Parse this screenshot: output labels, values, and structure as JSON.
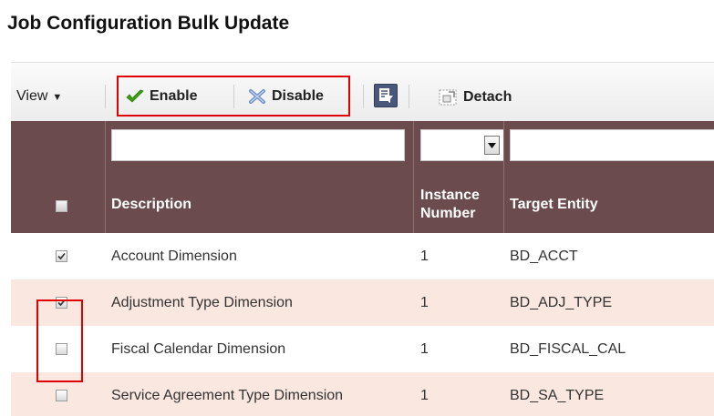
{
  "page": {
    "title": "Job Configuration Bulk Update"
  },
  "toolbar": {
    "view_label": "View",
    "view_caret": "▼",
    "enable_label": "Enable",
    "disable_label": "Disable",
    "detach_label": "Detach"
  },
  "table": {
    "columns": [
      "Description",
      "Instance\nNumber",
      "Target Entity"
    ],
    "column_instance_line1": "Instance",
    "column_instance_line2": "Number",
    "rows": [
      {
        "description": "Account Dimension",
        "instance": "1",
        "target": "BD_ACCT",
        "checked": true
      },
      {
        "description": "Adjustment Type Dimension",
        "instance": "1",
        "target": "BD_ADJ_TYPE",
        "checked": true
      },
      {
        "description": "Fiscal Calendar Dimension",
        "instance": "1",
        "target": "BD_FISCAL_CAL",
        "checked": false
      },
      {
        "description": "Service Agreement Type Dimension",
        "instance": "1",
        "target": "BD_SA_TYPE",
        "checked": false
      }
    ]
  },
  "colors": {
    "header_bg": "#6b4b4d",
    "row_alt_bg": "#fae7df",
    "highlight_border": "#e00000"
  }
}
